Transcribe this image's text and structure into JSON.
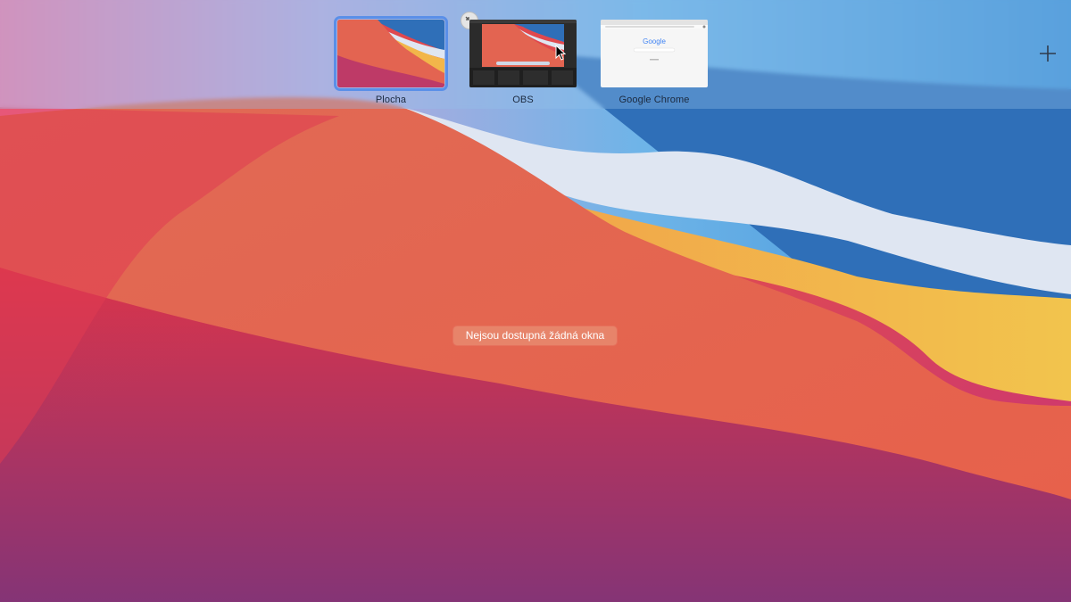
{
  "mission_control": {
    "spaces": [
      {
        "label": "Plocha",
        "active": true
      },
      {
        "label": "OBS",
        "active": false
      },
      {
        "label": "Google Chrome",
        "active": false
      }
    ],
    "chrome_thumb_logo": "Google",
    "empty_message": "Nejsou dostupná žádná okna",
    "add_space_icon": "plus-icon",
    "exit_fullscreen_icon": "exit-fullscreen-icon"
  },
  "colors": {
    "active_outline": "#5a8fe8",
    "bar_tint": "#96c3eb",
    "message_bg": "#e88a6e"
  }
}
